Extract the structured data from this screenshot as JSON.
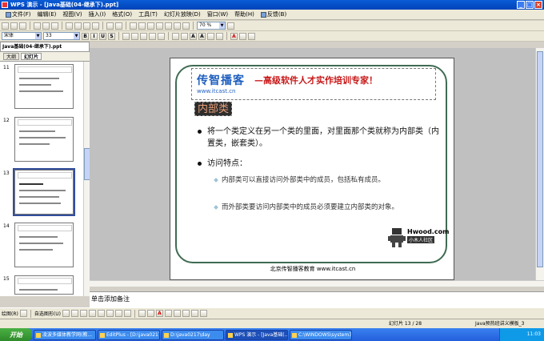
{
  "window": {
    "title": "WPS 演示 - [Java基础(04-继承下).ppt]",
    "controls": [
      "_",
      "□",
      "×"
    ]
  },
  "menu": [
    {
      "label": "文件(F)"
    },
    {
      "label": "编辑(E)"
    },
    {
      "label": "视图(V)"
    },
    {
      "label": "插入(I)"
    },
    {
      "label": "格式(O)"
    },
    {
      "label": "工具(T)"
    },
    {
      "label": "幻灯片放映(D)"
    },
    {
      "label": "窗口(W)"
    },
    {
      "label": "帮助(H)"
    },
    {
      "label": "反馈(B)"
    }
  ],
  "toolbar": {
    "zoom": "70 %",
    "font": "宋体",
    "font_size": "33"
  },
  "doc_tab": "Java基础(04-继承下).ppt",
  "panel_tabs": [
    {
      "label": "大纲"
    },
    {
      "label": "幻灯片"
    }
  ],
  "thumbnails": [
    {
      "num": "11"
    },
    {
      "num": "12"
    },
    {
      "num": "13"
    },
    {
      "num": "14"
    },
    {
      "num": "15"
    }
  ],
  "slide": {
    "brand": "传智播客",
    "url": "www.itcast.cn",
    "slogan": "—高级软件人才实作培训专家！",
    "heading": "内部类",
    "bullet1": "将一个类定义在另一个类的里面，对里面那个类就称为内部类（内置类，嵌套类）。",
    "bullet2": "访问特点：",
    "sub1": "内部类可以直接访问外部类中的成员，包括私有成员。",
    "sub2": "而外部类要访问内部类中的成员必须要建立内部类的对象。",
    "hwood1": "Hwood.com",
    "hwood2": "小木人社区",
    "footer": "北京传智播客教育 www.itcast.cn"
  },
  "notes_placeholder": "单击添加备注",
  "drawbar": {
    "draw_label": "绘图(R)",
    "autoshape_label": "自选图形(U)"
  },
  "status": {
    "slide_pos": "幻灯片 13 / 28",
    "template": "Java预热班讲义模板_3"
  },
  "taskbar": {
    "start": "开始",
    "items": [
      {
        "label": "凌波多媒体教学网(教..."
      },
      {
        "label": "EditPlus - [D:\\java0217\\..."
      },
      {
        "label": "D:\\java0217\\day"
      },
      {
        "label": "WPS 演示 - [Java基础(..."
      },
      {
        "label": "C:\\WINDOWS\\system32..."
      }
    ],
    "clock": "11:03"
  }
}
